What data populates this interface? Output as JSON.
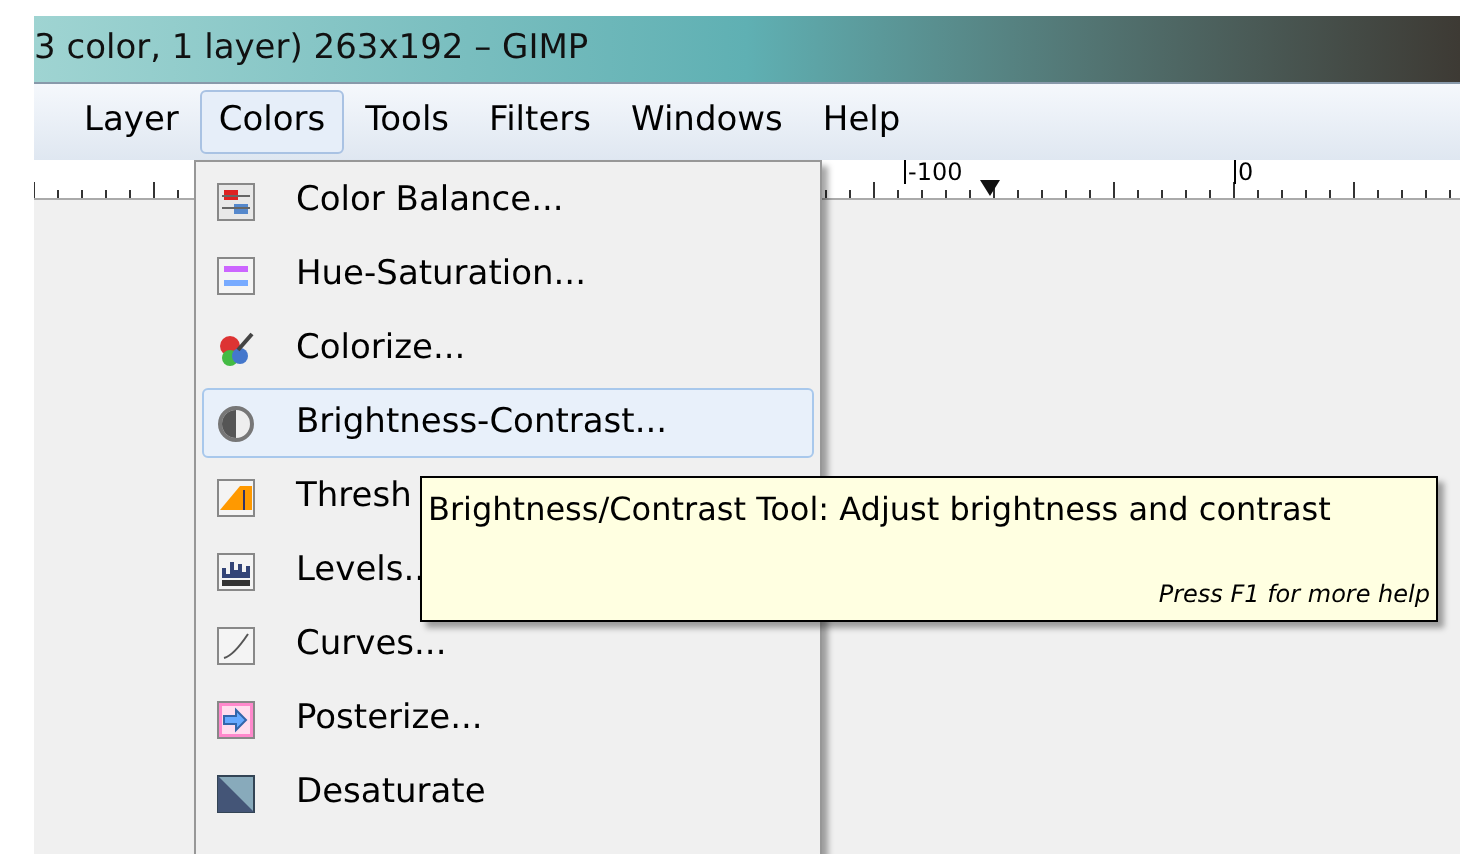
{
  "window": {
    "title": "3 color, 1 layer) 263x192 – GIMP"
  },
  "menubar": [
    {
      "label": "Layer",
      "selected": false
    },
    {
      "label": "Colors",
      "selected": true
    },
    {
      "label": "Tools",
      "selected": false
    },
    {
      "label": "Filters",
      "selected": false
    },
    {
      "label": "Windows",
      "selected": false
    },
    {
      "label": "Help",
      "selected": false
    }
  ],
  "ruler": {
    "labels": [
      "-100",
      "0"
    ]
  },
  "menu": {
    "items": [
      {
        "label": "Color Balance...",
        "selected": false
      },
      {
        "label": "Hue-Saturation...",
        "selected": false
      },
      {
        "label": "Colorize...",
        "selected": false
      },
      {
        "label": "Brightness-Contrast...",
        "selected": true
      },
      {
        "label": "Thresh",
        "selected": false
      },
      {
        "label": "Levels..",
        "selected": false
      },
      {
        "label": "Curves...",
        "selected": false
      },
      {
        "label": "Posterize...",
        "selected": false
      },
      {
        "label": "Desaturate",
        "selected": false
      }
    ]
  },
  "tooltip": {
    "text": "Brightness/Contrast Tool: Adjust brightness and contrast",
    "hint": "Press F1 for more help"
  }
}
